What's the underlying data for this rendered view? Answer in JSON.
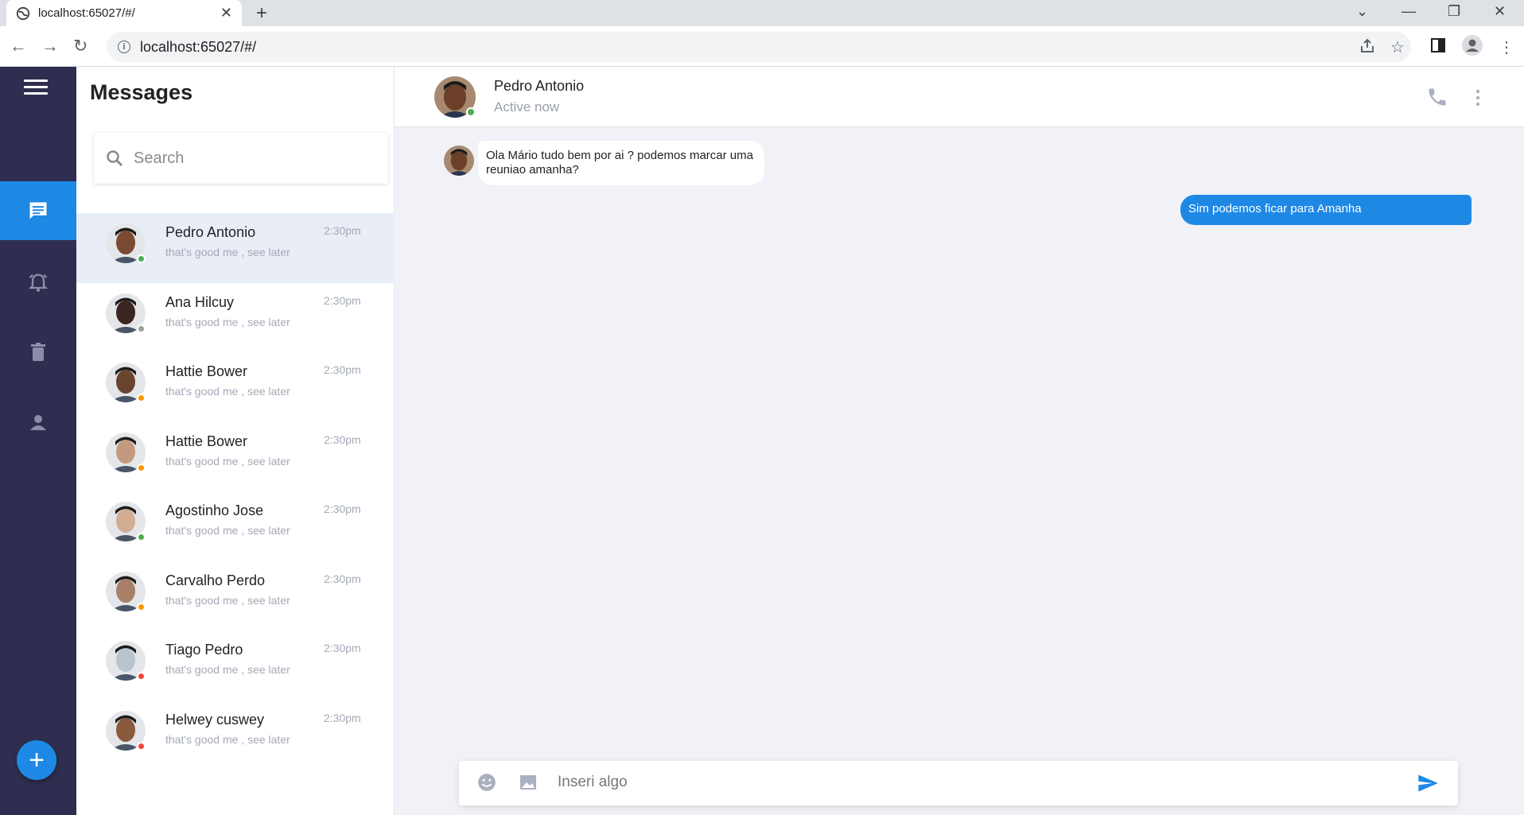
{
  "browser": {
    "tab_title": "localhost:65027/#/",
    "url": "localhost:65027/#/"
  },
  "sidebar": {
    "items": [
      {
        "name": "messages",
        "icon": "chat-icon",
        "active": true
      },
      {
        "name": "alerts",
        "icon": "alarm-icon",
        "active": false
      },
      {
        "name": "trash",
        "icon": "trash-icon",
        "active": false
      },
      {
        "name": "profile",
        "icon": "person-icon",
        "active": false
      }
    ],
    "fab_label": "+"
  },
  "messages_panel": {
    "title": "Messages",
    "search_placeholder": "Search",
    "contacts": [
      {
        "name": "Pedro Antonio",
        "preview": "that's good me , see later",
        "time": "2:30pm",
        "status": "#4caf50",
        "skin": "#7a4a32",
        "active": true
      },
      {
        "name": "Ana Hilcuy",
        "preview": "that's good me , see later",
        "time": "2:30pm",
        "status": "#9e9e9e",
        "skin": "#3a2620",
        "active": false
      },
      {
        "name": "Hattie Bower",
        "preview": "that's good me , see later",
        "time": "2:30pm",
        "status": "#ff9800",
        "skin": "#6b4430",
        "active": false
      },
      {
        "name": "Hattie Bower",
        "preview": "that's good me , see later",
        "time": "2:30pm",
        "status": "#ff9800",
        "skin": "#c49a7e",
        "active": false
      },
      {
        "name": "Agostinho Jose",
        "preview": "that's good me , see later",
        "time": "2:30pm",
        "status": "#4caf50",
        "skin": "#d2ad92",
        "active": false
      },
      {
        "name": "Carvalho Perdo",
        "preview": "that's good me , see later",
        "time": "2:30pm",
        "status": "#ff9800",
        "skin": "#a88068",
        "active": false
      },
      {
        "name": "Tiago Pedro",
        "preview": "that's good me , see later",
        "time": "2:30pm",
        "status": "#f44336",
        "skin": "#b9c4cf",
        "active": false
      },
      {
        "name": "Helwey cuswey",
        "preview": "that's good me , see later",
        "time": "2:30pm",
        "status": "#f44336",
        "skin": "#8a5a3c",
        "active": false
      }
    ]
  },
  "chat": {
    "contact_name": "Pedro Antonio",
    "contact_status": "Active now",
    "incoming_message": "Ola Mário tudo bem  por ai ? podemos marcar uma reuniao amanha?",
    "outgoing_message": "Sim podemos ficar para Amanha",
    "composer_placeholder": "Inseri algo"
  },
  "colors": {
    "rail": "#2f2e50",
    "accent": "#1e88e5",
    "chat_bg": "#f0f2f8"
  }
}
